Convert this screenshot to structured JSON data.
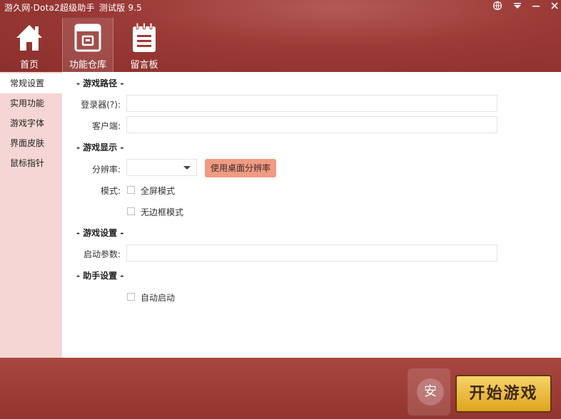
{
  "window": {
    "title": "游久网·Dota2超级助手",
    "version": "测试版 9.5",
    "controls": [
      "globe-icon",
      "menu-icon",
      "minimize-icon",
      "close-icon"
    ]
  },
  "topnav": [
    {
      "label": "首页",
      "icon": "home-icon"
    },
    {
      "label": "功能仓库",
      "icon": "warehouse-icon"
    },
    {
      "label": "留言板",
      "icon": "notepad-icon"
    }
  ],
  "sidebar": {
    "items": [
      {
        "label": "常规设置"
      },
      {
        "label": "实用功能"
      },
      {
        "label": "游戏字体"
      },
      {
        "label": "界面皮肤"
      },
      {
        "label": "鼠标指针"
      }
    ]
  },
  "sections": {
    "game_path": "- 游戏路径 -",
    "game_display": "- 游戏显示 -",
    "game_settings": "- 游戏设置 -",
    "helper_settings": "- 助手设置 -"
  },
  "fields": {
    "launcher_label": "登录器(?):",
    "launcher_value": "",
    "client_label": "客户端:",
    "client_value": "",
    "resolution_label": "分辨率:",
    "resolution_value": "",
    "use_desktop_res": "使用桌面分辨率",
    "mode_label": "模式:",
    "fullscreen_label": "全屏模式",
    "fullscreen_checked": false,
    "borderless_label": "无边框模式",
    "borderless_checked": false,
    "launch_params_label": "启动参数:",
    "launch_params_value": "",
    "autostart_label": "自动启动",
    "autostart_checked": false
  },
  "footer": {
    "start_button": "开始游戏",
    "watermark_icon": "安"
  },
  "colors": {
    "header": "#9b3a36",
    "sidebar": "#f6d6d4",
    "accent_button": "#f19a82",
    "start_button": "#e8b431"
  }
}
